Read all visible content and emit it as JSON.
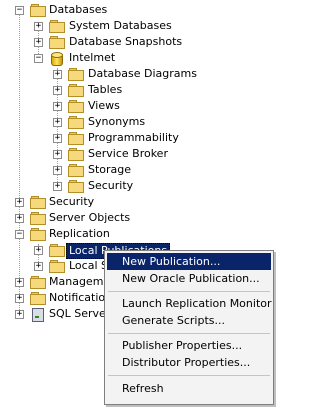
{
  "tree": {
    "databases": "Databases",
    "system_databases": "System Databases",
    "database_snapshots": "Database Snapshots",
    "intelmet": "Intelmet",
    "intelmet_children": [
      "Database Diagrams",
      "Tables",
      "Views",
      "Synonyms",
      "Programmability",
      "Service Broker",
      "Storage",
      "Security"
    ],
    "security": "Security",
    "server_objects": "Server Objects",
    "replication": "Replication",
    "local_publications": "Local Publications",
    "local_subscriptions": "Local Subscriptions",
    "management": "Management",
    "notification_services": "Notification Services",
    "sql_server_agent": "SQL Server Agent"
  },
  "context_menu": {
    "new_publication": "New Publication...",
    "new_oracle_publication": "New Oracle Publication...",
    "launch_replication_monitor": "Launch Replication Monitor",
    "generate_scripts": "Generate Scripts...",
    "publisher_properties": "Publisher Properties...",
    "distributor_properties": "Distributor Properties...",
    "refresh": "Refresh"
  },
  "icons": {
    "folder": "folder-icon",
    "database": "database-icon",
    "agent": "sql-agent-icon",
    "expand": "+",
    "collapse": "−"
  }
}
